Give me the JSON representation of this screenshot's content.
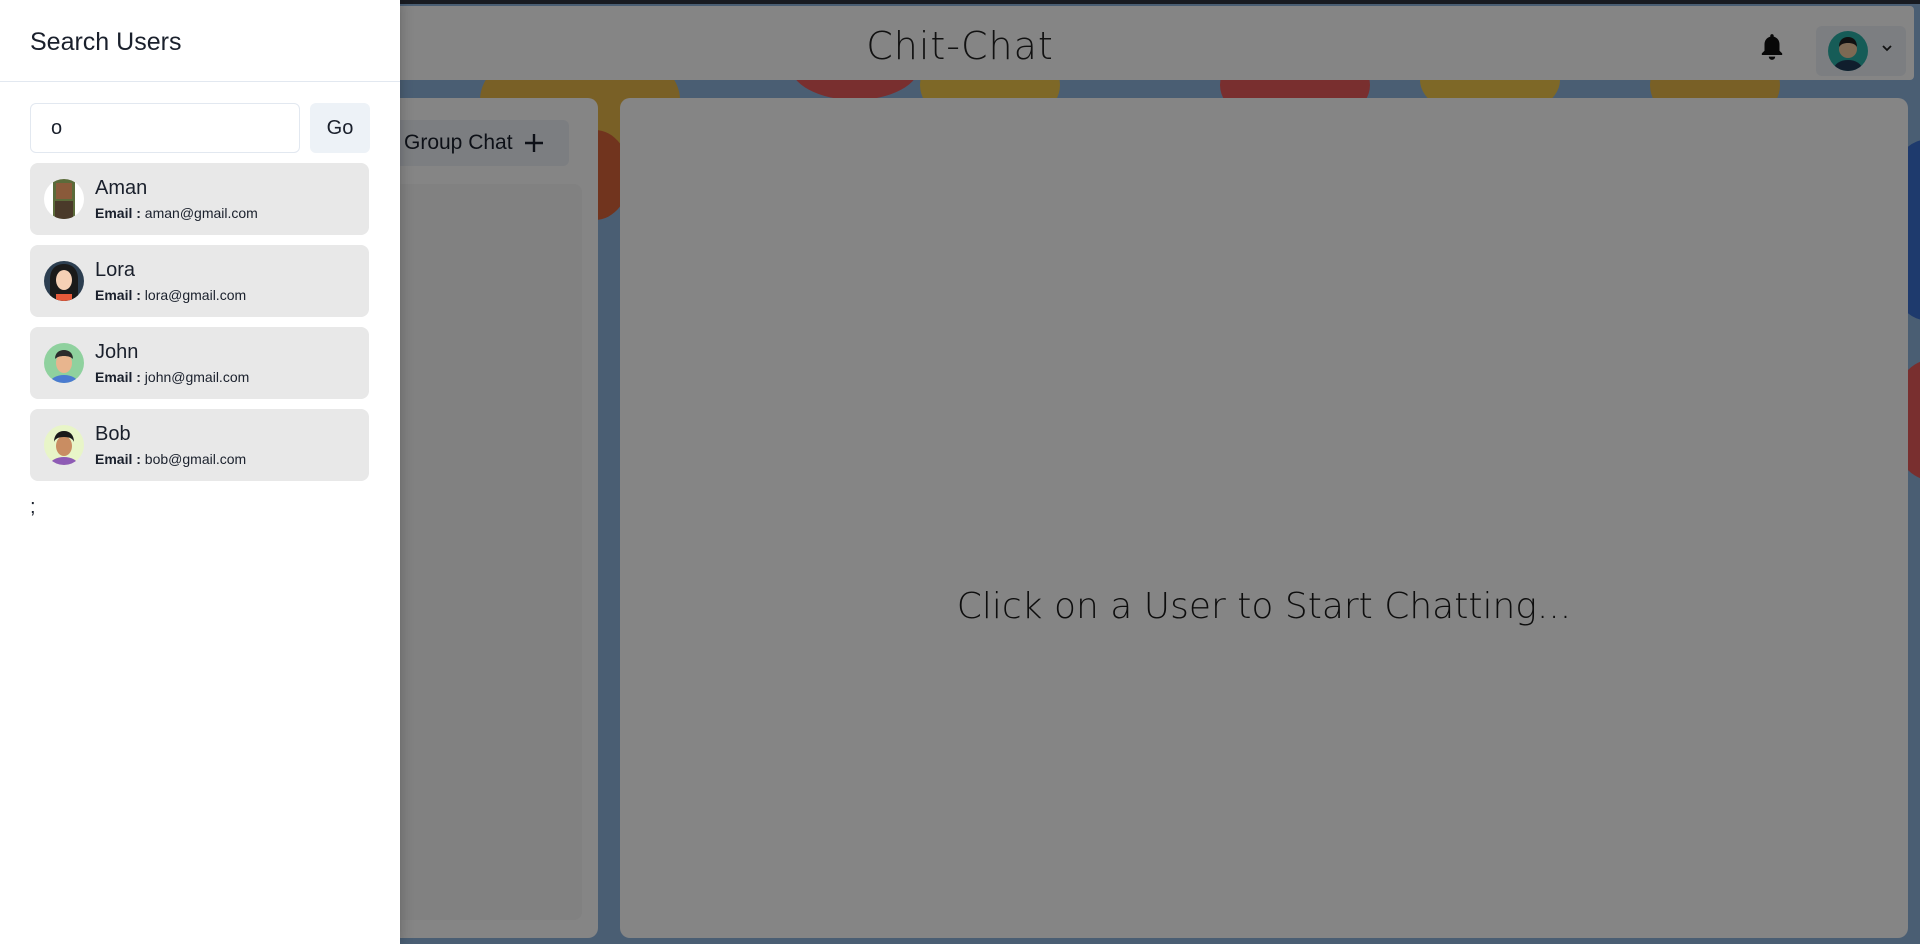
{
  "app": {
    "title": "Chit-Chat"
  },
  "header": {
    "bell_icon": "bell-icon",
    "chevron_icon": "chevron-down-icon"
  },
  "chats": {
    "group_chat_label": "Group Chat",
    "plus_icon": "plus-icon"
  },
  "chat_box": {
    "empty_message": "Click on a User to Start Chatting..."
  },
  "drawer": {
    "title": "Search Users",
    "search_value": "o",
    "go_label": "Go",
    "trailing_text": ";",
    "users": [
      {
        "name": "Aman",
        "email_label": "Email :",
        "email": "aman@gmail.com"
      },
      {
        "name": "Lora",
        "email_label": "Email :",
        "email": "lora@gmail.com"
      },
      {
        "name": "John",
        "email_label": "Email :",
        "email": "john@gmail.com"
      },
      {
        "name": "Bob",
        "email_label": "Email :",
        "email": "bob@gmail.com"
      }
    ]
  },
  "colors": {
    "overlay": "#000000",
    "panel": "#ffffff",
    "button_bg": "#edf2f7",
    "item_bg": "#e8e8e8"
  }
}
